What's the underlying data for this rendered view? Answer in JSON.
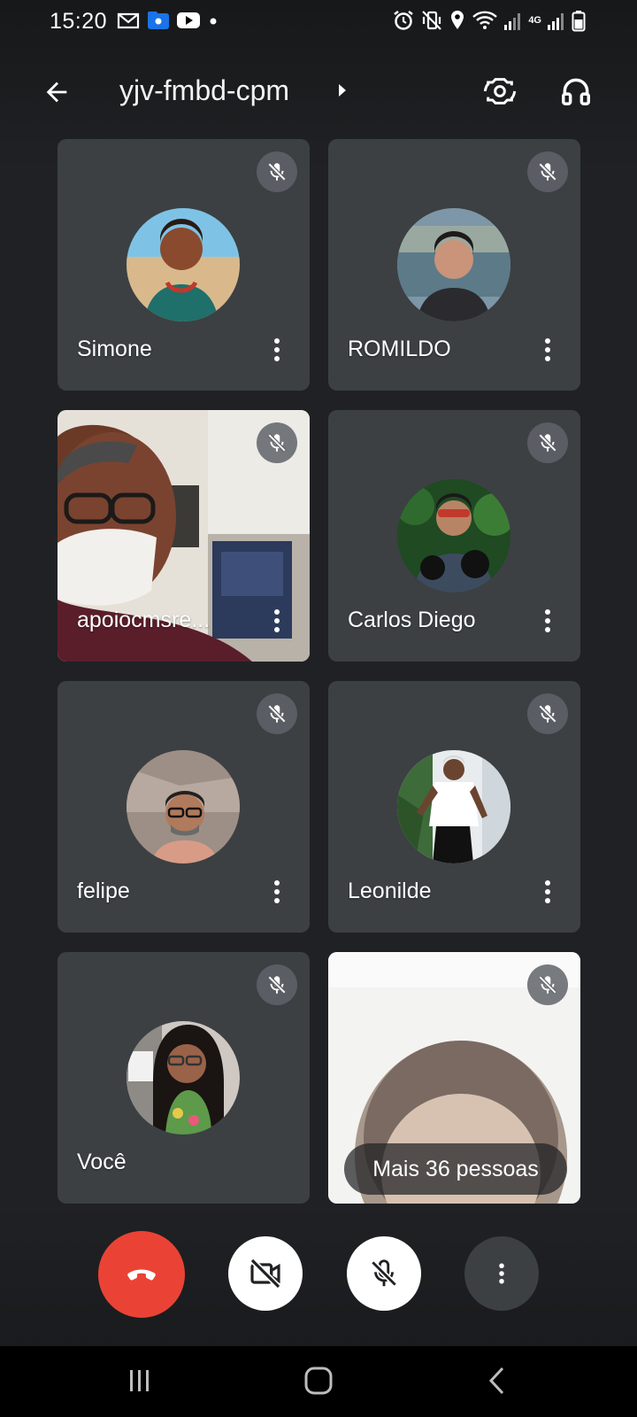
{
  "status_bar": {
    "time": "15:20",
    "network": "4G",
    "left_icons": [
      "gmail-icon",
      "files-icon",
      "youtube-icon",
      "dot-icon"
    ],
    "right_icons": [
      "alarm-icon",
      "vibrate-icon",
      "location-icon",
      "wifi-icon",
      "signal-icon",
      "signal-4g-icon",
      "battery-icon"
    ]
  },
  "top_bar": {
    "meeting_code": "yjv-fmbd-cpm"
  },
  "participants": [
    {
      "name": "Simone",
      "muted": true,
      "kind": "avatar"
    },
    {
      "name": "ROMILDO",
      "muted": true,
      "kind": "avatar"
    },
    {
      "name": "apoiocmsre...",
      "muted": true,
      "kind": "video"
    },
    {
      "name": "Carlos Diego",
      "muted": true,
      "kind": "avatar"
    },
    {
      "name": "felipe",
      "muted": true,
      "kind": "avatar"
    },
    {
      "name": "Leonilde",
      "muted": true,
      "kind": "avatar"
    },
    {
      "name": "Você",
      "muted": true,
      "kind": "avatar"
    },
    {
      "name": "",
      "muted": true,
      "kind": "video"
    }
  ],
  "overflow": {
    "label": "Mais 36 pessoas"
  },
  "colors": {
    "background": "#202124",
    "tile": "#3c4043",
    "end_call": "#ea4335",
    "mute_badge": "#5f6368"
  }
}
